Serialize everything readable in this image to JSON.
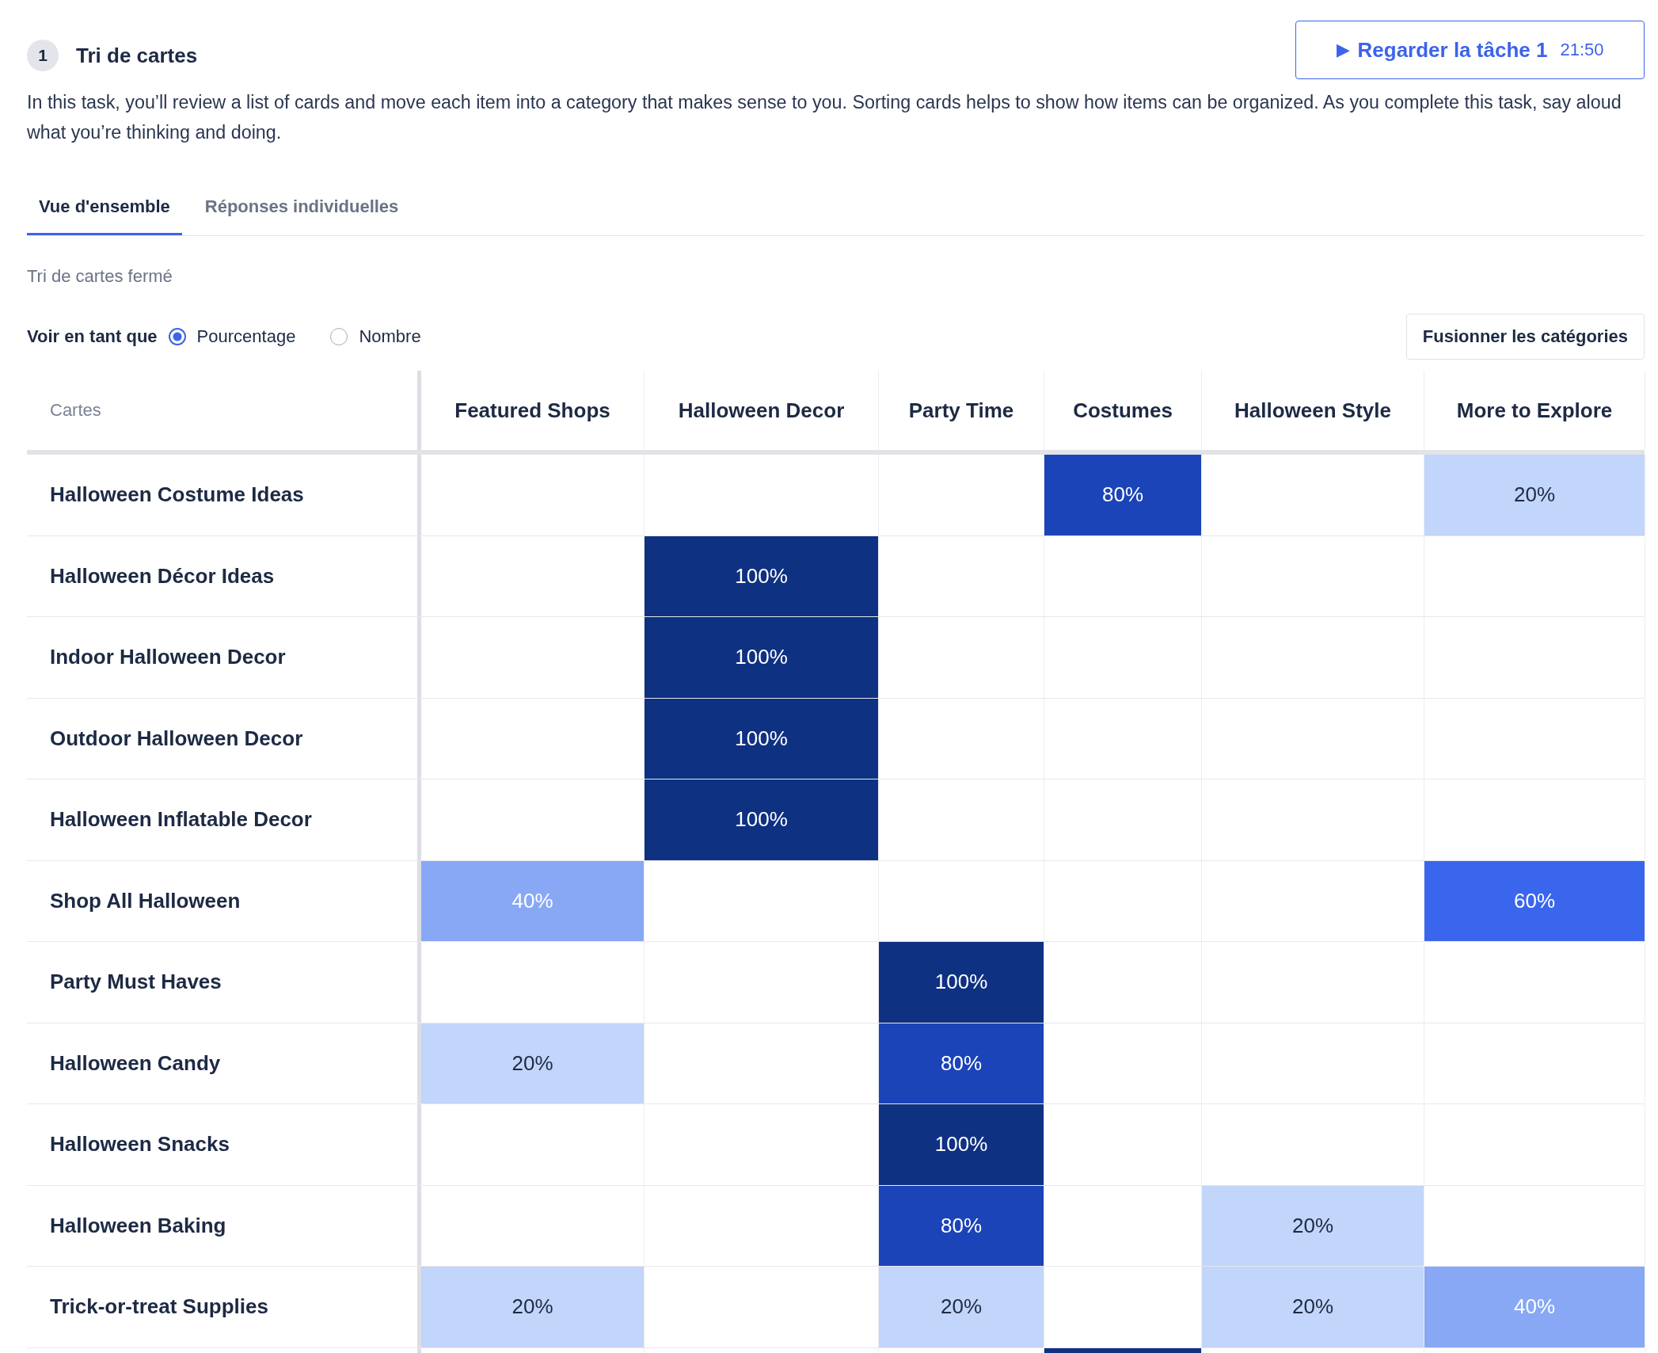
{
  "task": {
    "number": "1",
    "title": "Tri de cartes",
    "description": "In this task, you’ll review a list of cards and move each item into a category that makes sense to you. Sorting cards helps to show how items can be organized. As you complete this task, say aloud what you’re thinking and doing.",
    "watch_button": {
      "icon": "▶",
      "label": "Regarder la tâche 1",
      "time": "21:50"
    }
  },
  "tabs": [
    {
      "label": "Vue d'ensemble",
      "selected": true
    },
    {
      "label": "Réponses individuelles",
      "selected": false
    }
  ],
  "sort_type": "Tri de cartes fermé",
  "view_as": {
    "label": "Voir en tant que",
    "options": [
      {
        "label": "Pourcentage",
        "selected": true
      },
      {
        "label": "Nombre",
        "selected": false
      }
    ]
  },
  "merge_button": "Fusionner les catégories",
  "table": {
    "corner": "Cartes",
    "columns": [
      "Featured Shops",
      "Halloween Decor",
      "Party Time",
      "Costumes",
      "Halloween Style",
      "More to Explore"
    ],
    "rows": [
      {
        "card": "Halloween Costume Ideas",
        "cells": [
          null,
          null,
          null,
          {
            "text": "80%",
            "color": "#1b44b8"
          },
          null,
          {
            "text": "20%",
            "color": "#c2d5fa"
          }
        ]
      },
      {
        "card": "Halloween Décor Ideas",
        "cells": [
          null,
          {
            "text": "100%",
            "color": "#0f3182"
          },
          null,
          null,
          null,
          null
        ]
      },
      {
        "card": "Indoor Halloween Decor",
        "cells": [
          null,
          {
            "text": "100%",
            "color": "#0f3182"
          },
          null,
          null,
          null,
          null
        ]
      },
      {
        "card": "Outdoor Halloween Decor",
        "cells": [
          null,
          {
            "text": "100%",
            "color": "#0f3182"
          },
          null,
          null,
          null,
          null
        ]
      },
      {
        "card": "Halloween Inflatable Decor",
        "cells": [
          null,
          {
            "text": "100%",
            "color": "#0f3182"
          },
          null,
          null,
          null,
          null
        ]
      },
      {
        "card": "Shop All Halloween",
        "cells": [
          {
            "text": "40%",
            "color": "#88a8f6"
          },
          null,
          null,
          null,
          null,
          {
            "text": "60%",
            "color": "#3a66ee"
          }
        ]
      },
      {
        "card": "Party Must Haves",
        "cells": [
          null,
          null,
          {
            "text": "100%",
            "color": "#0f3182"
          },
          null,
          null,
          null
        ]
      },
      {
        "card": "Halloween Candy",
        "cells": [
          {
            "text": "20%",
            "color": "#c2d5fa"
          },
          null,
          {
            "text": "80%",
            "color": "#1b44b8"
          },
          null,
          null,
          null
        ]
      },
      {
        "card": "Halloween Snacks",
        "cells": [
          null,
          null,
          {
            "text": "100%",
            "color": "#0f3182"
          },
          null,
          null,
          null
        ]
      },
      {
        "card": "Halloween Baking",
        "cells": [
          null,
          null,
          {
            "text": "80%",
            "color": "#1b44b8"
          },
          null,
          {
            "text": "20%",
            "color": "#c2d5fa"
          },
          null
        ]
      },
      {
        "card": "Trick-or-treat Supplies",
        "cells": [
          {
            "text": "20%",
            "color": "#c2d5fa"
          },
          null,
          {
            "text": "20%",
            "color": "#c2d5fa"
          },
          null,
          {
            "text": "20%",
            "color": "#c2d5fa"
          },
          {
            "text": "40%",
            "color": "#88a8f6"
          }
        ]
      },
      {
        "cells": [
          null,
          null,
          null,
          {
            "color": "#0f3182"
          },
          null,
          null
        ]
      }
    ]
  }
}
